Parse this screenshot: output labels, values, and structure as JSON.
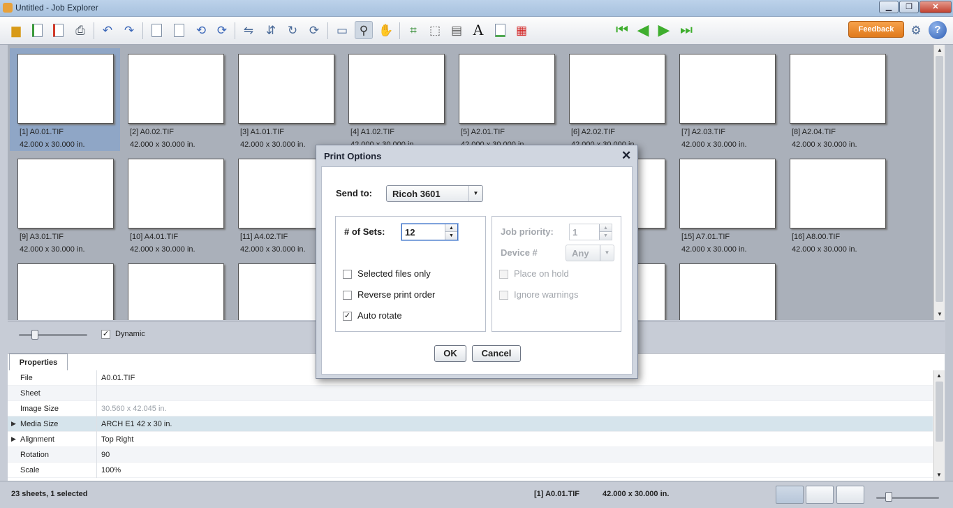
{
  "window": {
    "title": "Untitled - Job Explorer",
    "min_label": "▁",
    "max_label": "❐",
    "close_label": "✕"
  },
  "toolbar": {
    "feedback_label": "Feedback",
    "help_label": "?",
    "text_tool_label": "A",
    "icons": [
      "open-folder",
      "add-file",
      "remove-file",
      "print",
      "undo",
      "redo",
      "page-copy",
      "page-copy-2",
      "rotate-left",
      "rotate-right",
      "mirror-h",
      "mirror-v",
      "rotate-sheet",
      "refresh",
      "fit-window",
      "zoom",
      "pan",
      "crop",
      "select-area",
      "annotate",
      "text",
      "blank-page",
      "color-grid",
      "first-page",
      "prev-page",
      "next-page",
      "last-page"
    ]
  },
  "thumbnails": [
    {
      "caption": "[1] A0.01.TIF",
      "size": "42.000 x 30.000 in.",
      "selected": true
    },
    {
      "caption": "[2] A0.02.TIF",
      "size": "42.000 x 30.000 in."
    },
    {
      "caption": "[3] A1.01.TIF",
      "size": "42.000 x 30.000 in."
    },
    {
      "caption": "[4] A1.02.TIF",
      "size": "42.000 x 30.000 in."
    },
    {
      "caption": "[5] A2.01.TIF",
      "size": "42.000 x 30.000 in."
    },
    {
      "caption": "[6] A2.02.TIF",
      "size": "42.000 x 30.000 in."
    },
    {
      "caption": "[7] A2.03.TIF",
      "size": "42.000 x 30.000 in."
    },
    {
      "caption": "[8] A2.04.TIF",
      "size": "42.000 x 30.000 in."
    },
    {
      "caption": "[9] A3.01.TIF",
      "size": "42.000 x 30.000 in."
    },
    {
      "caption": "[10] A4.01.TIF",
      "size": "42.000 x 30.000 in."
    },
    {
      "caption": "[11] A4.02.TIF",
      "size": "42.000 x 30.000 in."
    },
    {
      "caption": "[15] A7.01.TIF",
      "size": "42.000 x 30.000 in."
    },
    {
      "caption": "[16] A8.00.TIF",
      "size": "42.000 x 30.000 in."
    }
  ],
  "zoom": {
    "dynamic_label": "Dynamic",
    "dynamic_checked": true
  },
  "properties": {
    "tab_label": "Properties",
    "rows": [
      {
        "key": "File",
        "value": "A0.01.TIF"
      },
      {
        "key": "Sheet",
        "value": ""
      },
      {
        "key": "Image Size",
        "value": "30.560 x 42.045 in."
      },
      {
        "key": "Media Size",
        "value": "ARCH E1 42 x 30 in."
      },
      {
        "key": "Alignment",
        "value": "Top Right"
      },
      {
        "key": "Rotation",
        "value": "90"
      },
      {
        "key": "Scale",
        "value": "100%"
      }
    ]
  },
  "status": {
    "summary": "23 sheets, 1 selected",
    "file": "[1] A0.01.TIF",
    "size": "42.000 x 30.000 in."
  },
  "dialog": {
    "title": "Print Options",
    "close_label": "✕",
    "send_to_label": "Send to:",
    "send_to_value": "Ricoh 3601",
    "sets_label": "# of Sets:",
    "sets_value": "12",
    "job_priority_label": "Job priority:",
    "job_priority_value": "1",
    "device_label": "Device #",
    "device_value": "Any",
    "selected_files_label": "Selected files only",
    "reverse_order_label": "Reverse print order",
    "auto_rotate_label": "Auto rotate",
    "place_on_hold_label": "Place on hold",
    "ignore_warnings_label": "Ignore warnings",
    "ok_label": "OK",
    "cancel_label": "Cancel"
  }
}
